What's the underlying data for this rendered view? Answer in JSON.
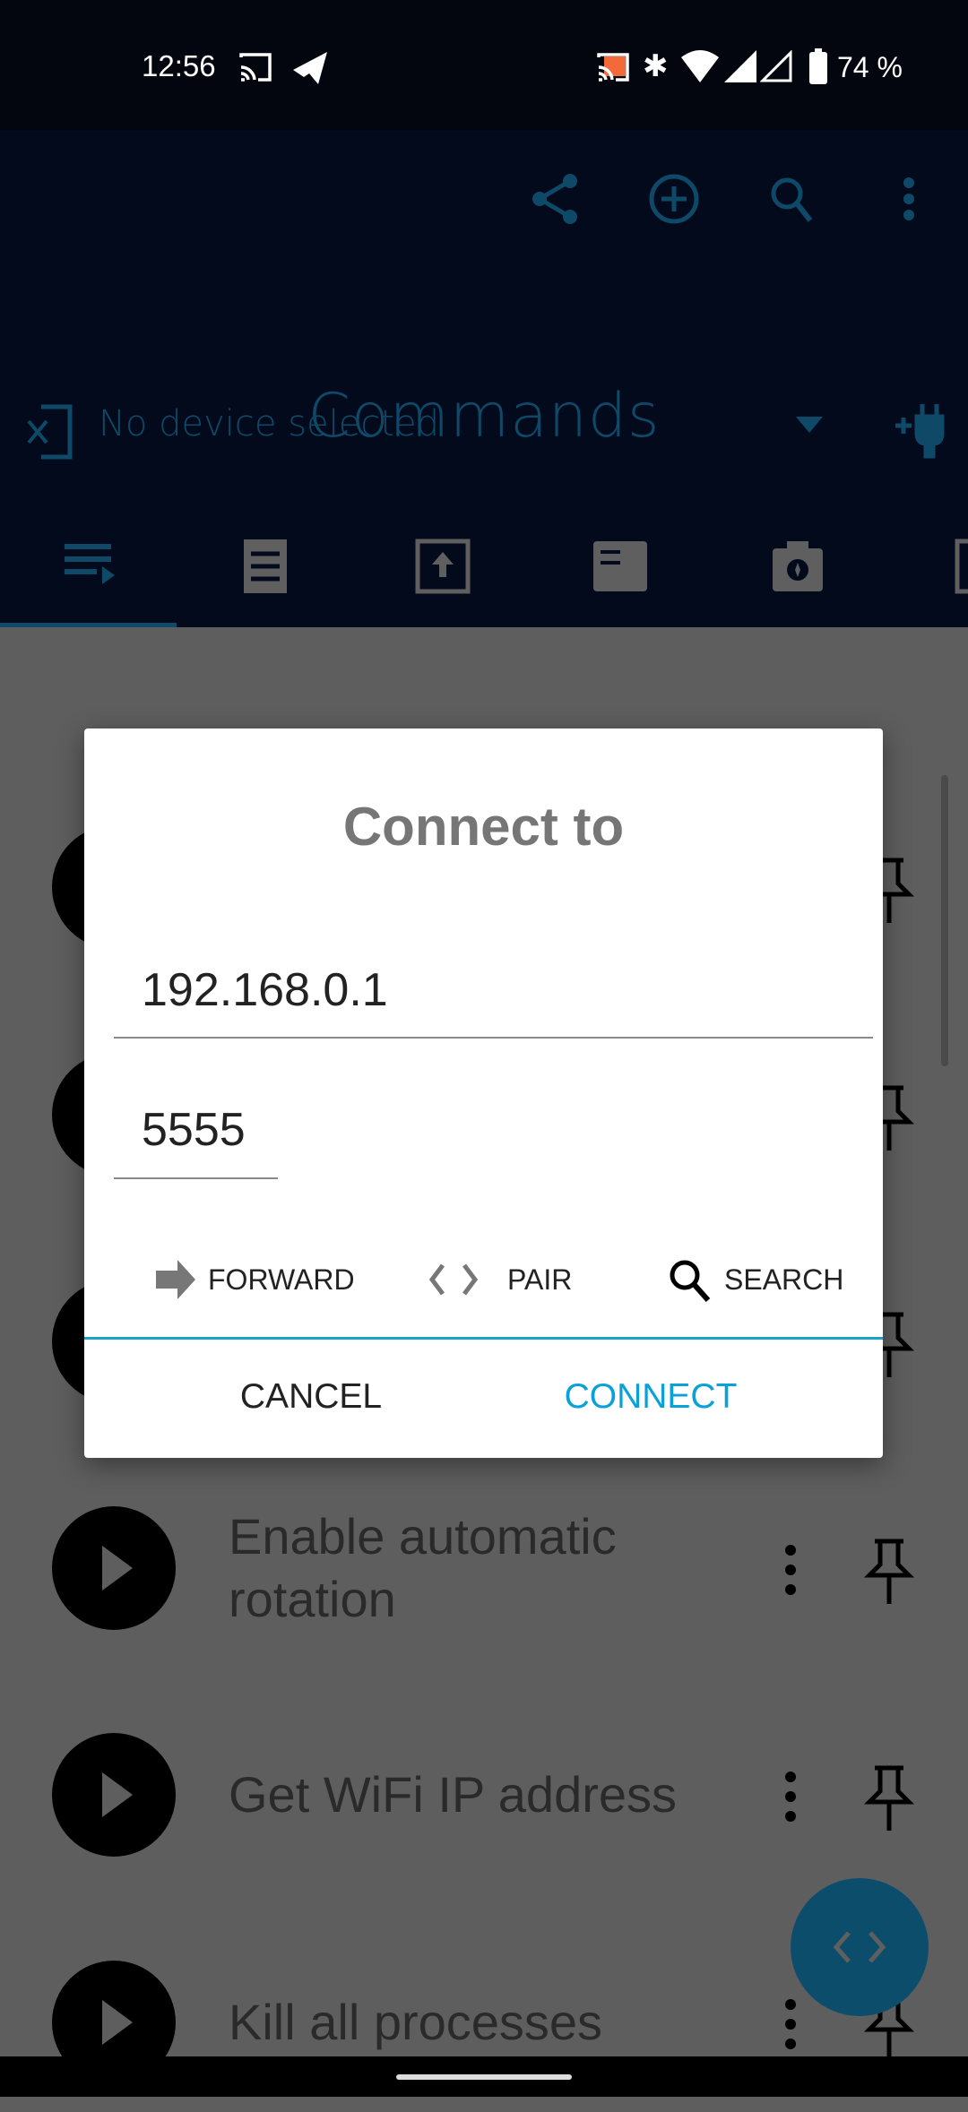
{
  "status_bar": {
    "time": "12:56",
    "battery": "74 %"
  },
  "toolbar": {
    "title": "Commands",
    "device": "No device selected",
    "icons": [
      "share-icon",
      "add-circle-icon",
      "search-icon",
      "more-vert-icon"
    ]
  },
  "tabs": [
    "commands-tab",
    "logcat-tab",
    "upload-tab",
    "files-tab",
    "screenshot-tab",
    "more-tab"
  ],
  "list": {
    "items": [
      "",
      "",
      "",
      "Enable automatic rotation",
      "Get WiFi IP address",
      "Kill all processes"
    ]
  },
  "dialog": {
    "title": "Connect to",
    "host": "192.168.0.1",
    "port": "5555",
    "forward": "FORWARD",
    "pair": "PAIR",
    "search": "SEARCH",
    "cancel": "CANCEL",
    "connect": "CONNECT"
  },
  "colors": {
    "accent": "#1aa2c9",
    "connect": "#0aa0d8",
    "toolbar": "#0f4968"
  }
}
